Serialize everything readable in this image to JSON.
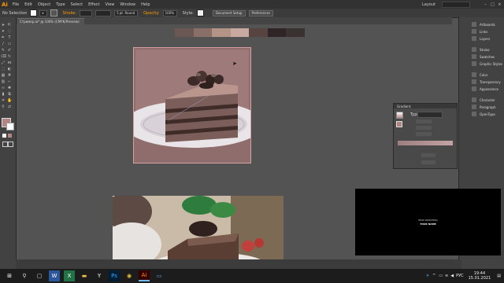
{
  "menubar": {
    "logo": "Ai",
    "items": [
      "File",
      "Edit",
      "Object",
      "Type",
      "Select",
      "Effect",
      "View",
      "Window",
      "Help"
    ],
    "layout": "Layout"
  },
  "controlbar": {
    "selection_label": "No Selection",
    "stroke_label": "Stroke:",
    "brush_label": "5 pt. Round",
    "opacity_label": "Opacity:",
    "opacity_value": "100%",
    "style_label": "Style:",
    "doc_setup_label": "Document Setup",
    "preferences_label": "Preferences"
  },
  "document": {
    "tab_title": "Стример.ai* @ 100% (CMYK/Preview)"
  },
  "colors": {
    "palette": [
      "#6b5753",
      "#8a6e68",
      "#b49487",
      "#c8a9a1",
      "#574441",
      "#2f2426",
      "#3a3131"
    ],
    "artboard_bg": "#987777",
    "plate": "#e8e2e4",
    "cake_top": "#b5928c",
    "cake_side": "#7a5d58",
    "cake_layer": "#3f2c29"
  },
  "right_panels": [
    {
      "label": "Artboards",
      "icon": "artboards-icon"
    },
    {
      "label": "Links",
      "icon": "links-icon"
    },
    {
      "label": "Layers",
      "icon": "layers-icon"
    },
    {
      "label": "Stroke",
      "icon": "stroke-icon"
    },
    {
      "label": "Swatches",
      "icon": "swatches-icon"
    },
    {
      "label": "Graphic Styles",
      "icon": "graphic-styles-icon"
    },
    {
      "label": "Color",
      "icon": "color-icon"
    },
    {
      "label": "Transparency",
      "icon": "transparency-icon"
    },
    {
      "label": "Appearance",
      "icon": "appearance-icon"
    },
    {
      "label": "Character",
      "icon": "character-icon"
    },
    {
      "label": "Paragraph",
      "icon": "paragraph-icon"
    },
    {
      "label": "OpenType",
      "icon": "opentype-icon"
    }
  ],
  "gradient_panel": {
    "title": "Gradient",
    "type_label": "Type:"
  },
  "video_overlay": {
    "line1": "NOW WATCHING",
    "line2": "YOUR NAME"
  },
  "taskbar": {
    "lang": "РУС",
    "time": "19:44",
    "date": "15.01.2021"
  }
}
